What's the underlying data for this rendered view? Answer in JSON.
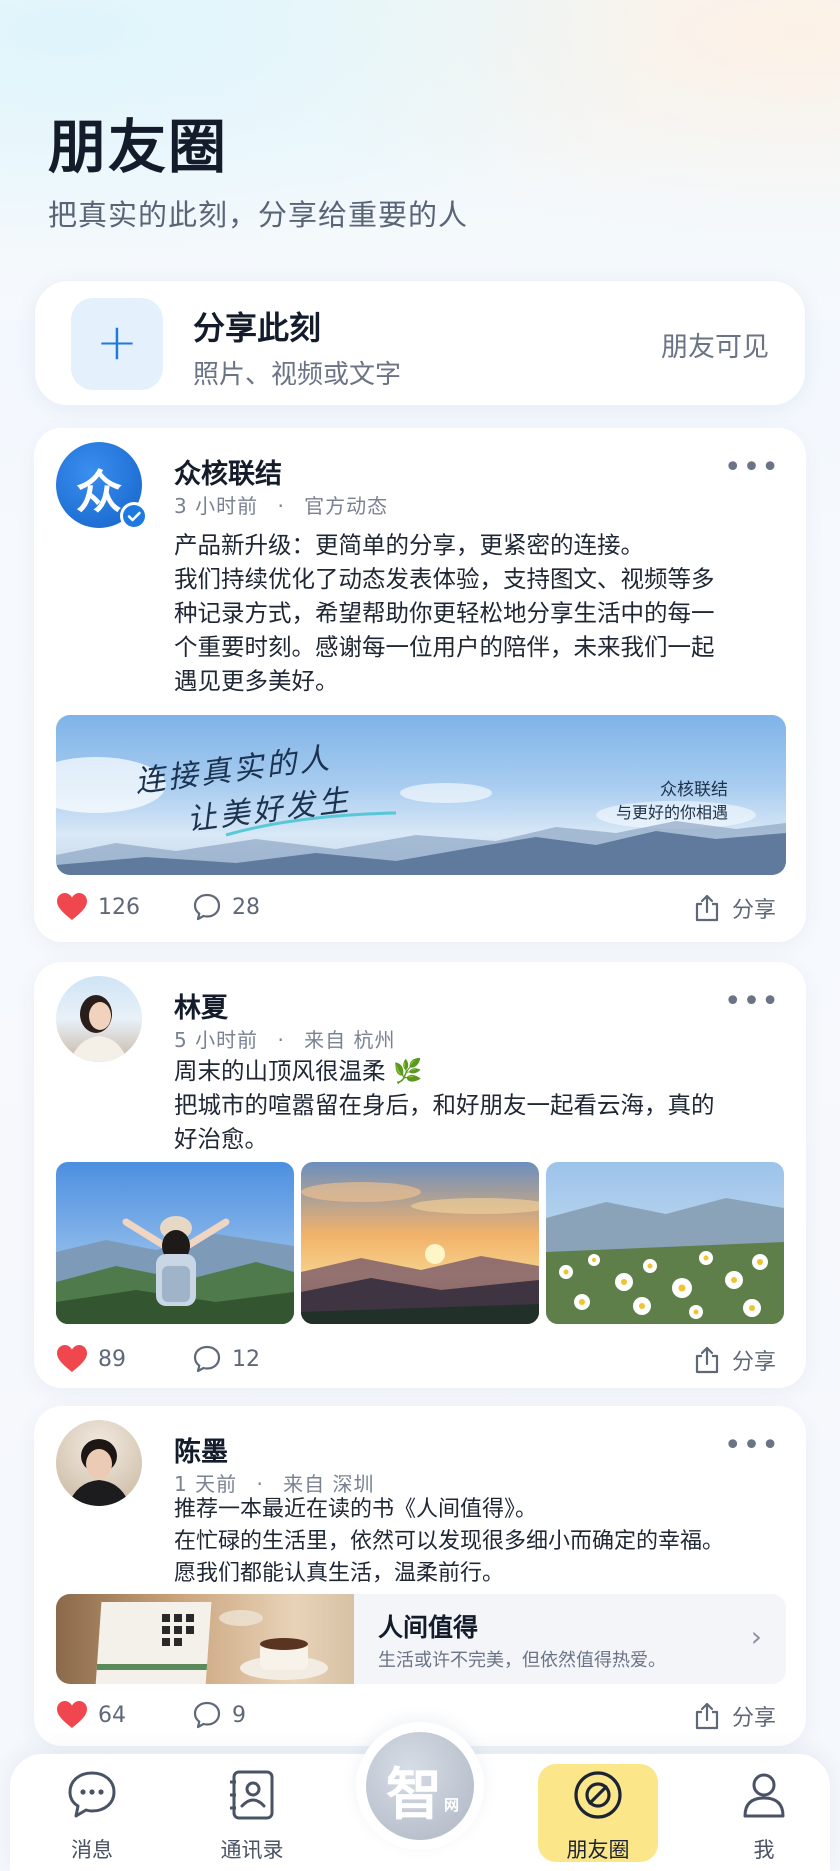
{
  "header": {
    "title": "朋友圈",
    "subtitle": "把真实的此刻，分享给重要的人"
  },
  "composer": {
    "plus": "+",
    "title": "分享此刻",
    "subtitle": "照片、视频或文字",
    "visibility": "朋友可见"
  },
  "posts": [
    {
      "author": "众核联结",
      "avatar_text": "众",
      "verified": true,
      "time": "3 小时前",
      "source": "官方动态",
      "lines": [
        "产品新升级：更简单的分享，更紧密的连接。",
        "我们持续优化了动态发表体验，支持图文、视频等多",
        "种记录方式，希望帮助你更轻松地分享生活中的每一",
        "个重要时刻。感谢每一位用户的陪伴，未来我们一起",
        "遇见更多美好。"
      ],
      "banner": {
        "line1": "连接真实的人",
        "line2": "让美好发生",
        "brand": "众核联结",
        "tagline": "与更好的你相遇"
      },
      "likes": "126",
      "comments": "28",
      "share": "分享"
    },
    {
      "author": "林夏",
      "time": "5 小时前",
      "source": "来自  杭州",
      "lines": [
        "周末的山顶风很温柔 🌿",
        "把城市的喧嚣留在身后，和好朋友一起看云海，真的",
        "好治愈。"
      ],
      "likes": "89",
      "comments": "12",
      "share": "分享"
    },
    {
      "author": "陈墨",
      "time": "1 天前",
      "source": "来自  深圳",
      "lines": [
        "推荐一本最近在读的书《人间值得》。",
        "在忙碌的生活里，依然可以发现很多细小而确定的幸福。",
        "愿我们都能认真生活，温柔前行。"
      ],
      "book": {
        "title": "人间值得",
        "desc": "生活或许不完美，但依然值得热爱。"
      },
      "likes": "64",
      "comments": "9",
      "share": "分享"
    }
  ],
  "nav": {
    "messages": "消息",
    "contacts": "通讯录",
    "center_big": "智",
    "center_small": "网",
    "moments": "朋友圈",
    "me": "我"
  },
  "colors": {
    "accent": "#1f7ae0",
    "like": "#f0474f",
    "active_tab": "#fbe78a"
  }
}
